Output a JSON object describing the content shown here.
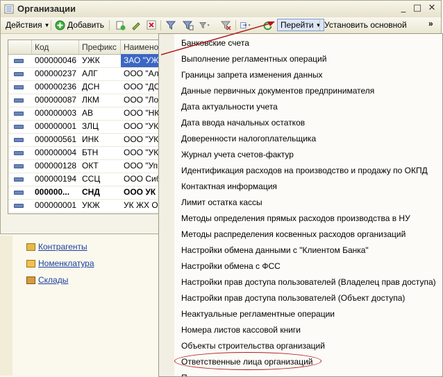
{
  "window": {
    "title": "Организации",
    "controls": {
      "minimize": "_",
      "maximize": "□",
      "close": "✕"
    }
  },
  "toolbar": {
    "actions_label": "Действия",
    "add_label": "Добавить",
    "goto_label": "Перейти",
    "set_main_label": "Установить основной",
    "overflow": "»"
  },
  "table": {
    "columns": [
      "Код",
      "Префикс",
      "Наименов"
    ],
    "rows": [
      {
        "code": "000000046",
        "prefix": "УЖК",
        "name": "ЗАО \"УЖ",
        "selected": true
      },
      {
        "code": "000000237",
        "prefix": "АЛГ",
        "name": "ООО \"Алг"
      },
      {
        "code": "000000236",
        "prefix": "ДСН",
        "name": "ООО \"ДО"
      },
      {
        "code": "000000087",
        "prefix": "ЛКМ",
        "name": "ООО \"Лок"
      },
      {
        "code": "000000003",
        "prefix": "АВ",
        "name": "ООО \"НКА"
      },
      {
        "code": "000000001",
        "prefix": "ЗЛЦ",
        "name": "ООО \"УК"
      },
      {
        "code": "000000561",
        "prefix": "ИНК",
        "name": "ООО \"УК"
      },
      {
        "code": "000000004",
        "prefix": "БТН",
        "name": "ООО \"УК"
      },
      {
        "code": "000000128",
        "prefix": "ОКТ",
        "name": "ООО \"Упр"
      },
      {
        "code": "000000194",
        "prefix": "ССЦ",
        "name": "ООО Сиб"
      },
      {
        "code": "000000...",
        "prefix": "СНД",
        "name": "ООО УК",
        "bold": true
      },
      {
        "code": "000000001",
        "prefix": "УКЖ",
        "name": "УК ЖХ Ок"
      }
    ]
  },
  "nav_links": [
    "Контрагенты",
    "Номенклатура",
    "Склады"
  ],
  "menu": {
    "items": [
      "Банковские счета",
      "Выполнение регламентных операций",
      "Границы запрета изменения данных",
      "Данные первичных документов предпринимателя",
      "Дата актуальности учета",
      "Дата ввода начальных остатков",
      "Доверенности налогоплательщика",
      "Журнал учета счетов-фактур",
      "Идентификация расходов на производство и продажу по ОКПД",
      "Контактная информация",
      "Лимит остатка кассы",
      "Методы определения прямых расходов производства в НУ",
      "Методы распределения косвенных расходов организаций",
      "Настройки обмена данными с \"Клиентом Банка\"",
      "Настройки обмена с ФСС",
      "Настройки прав доступа пользователей (Владелец прав доступа)",
      "Настройки прав доступа пользователей (Объект доступа)",
      "Неактуальные регламентные операции",
      "Номера листов кассовой книги",
      "Объекты строительства организаций",
      "Ответственные лица организаций",
      "П"
    ],
    "highlighted_index": 20
  },
  "colors": {
    "annotation": "#b01818",
    "selection": "#3b66c4"
  }
}
